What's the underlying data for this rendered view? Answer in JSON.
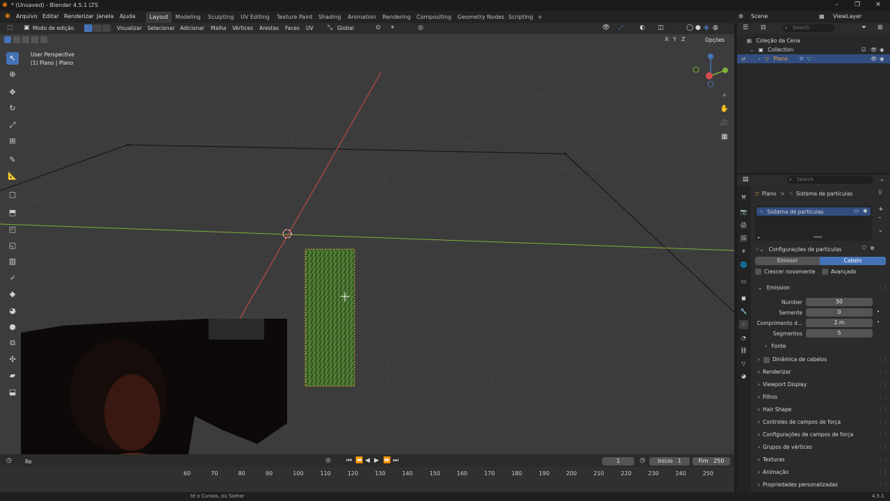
{
  "window": {
    "title": "* (Unsaved) - Blender 4.5.1 LTS",
    "min_icon": "minimize-icon",
    "max_icon": "maximize-icon",
    "close_icon": "close-icon"
  },
  "menu": [
    "Arquivo",
    "Editar",
    "Renderizar",
    "Janela",
    "Ajuda"
  ],
  "workspaces": [
    "Layout",
    "Modeling",
    "Sculpting",
    "UV Editing",
    "Texture Paint",
    "Shading",
    "Animation",
    "Rendering",
    "Compositing",
    "Geometry Nodes",
    "Scripting",
    "+"
  ],
  "scene": {
    "name": "Scene",
    "view_layer": "ViewLayer"
  },
  "viewport_header": {
    "mode": "Modo de edição",
    "menus": [
      "Visualizar",
      "Selecionar",
      "Adicionar",
      "Malha",
      "Vértices",
      "Arestas",
      "Faces",
      "UV"
    ],
    "orientation": "Global",
    "options": "Opções",
    "axes": [
      "X",
      "Y",
      "Z"
    ]
  },
  "viewport": {
    "perspective": "User Perspective",
    "object_info": "(1) Plano | Plano"
  },
  "timeline": {
    "current_frame": "1",
    "start_label": "Início",
    "start": "1",
    "end_label": "Fim",
    "end": "250",
    "ticks": [
      "60",
      "70",
      "80",
      "90",
      "100",
      "110",
      "120",
      "130",
      "140",
      "150",
      "160",
      "170",
      "180",
      "190",
      "200",
      "210",
      "220",
      "230",
      "240",
      "250"
    ],
    "left_label": "Re"
  },
  "statusbar": {
    "hint": "té o Cursos, ou Somar",
    "version": "4.5.1"
  },
  "outliner": {
    "search_placeholder": "Search",
    "scene_collection": "Coleção da Cena",
    "collection": "Collection",
    "object": "Plano"
  },
  "properties": {
    "search_placeholder": "Search",
    "breadcrumb_object": "Plano",
    "breadcrumb_sep": ">",
    "breadcrumb_system": "Sistema de partículas",
    "particle_system_item": "Sistema de partículas",
    "settings_name": "Configurações de partículas",
    "type_emitter": "Emissor",
    "type_hair": "Cabelo",
    "regrow": "Crescer novamente",
    "advanced": "Avançado",
    "emission_header": "Emission",
    "fields": [
      {
        "label": "Number",
        "value": "50"
      },
      {
        "label": "Semente",
        "value": "0"
      },
      {
        "label": "Comprimento d...",
        "value": "2 m"
      },
      {
        "label": "Segmentos",
        "value": "5"
      }
    ],
    "source": "Fonte",
    "panels": [
      "Dinâmica de cabelos",
      "Renderizar",
      "Viewport Display",
      "Filhos",
      "Hair Shape",
      "Controles de campos de força",
      "Configurações de campos de força",
      "Grupos de vértices",
      "Texturas",
      "Animação",
      "Propriedades personalizadas"
    ]
  },
  "colors": {
    "accent": "#4673b8",
    "viewport_bg": "#3c3c3c",
    "x_axis": "#d94c4c",
    "y_axis": "#7fb33a"
  }
}
